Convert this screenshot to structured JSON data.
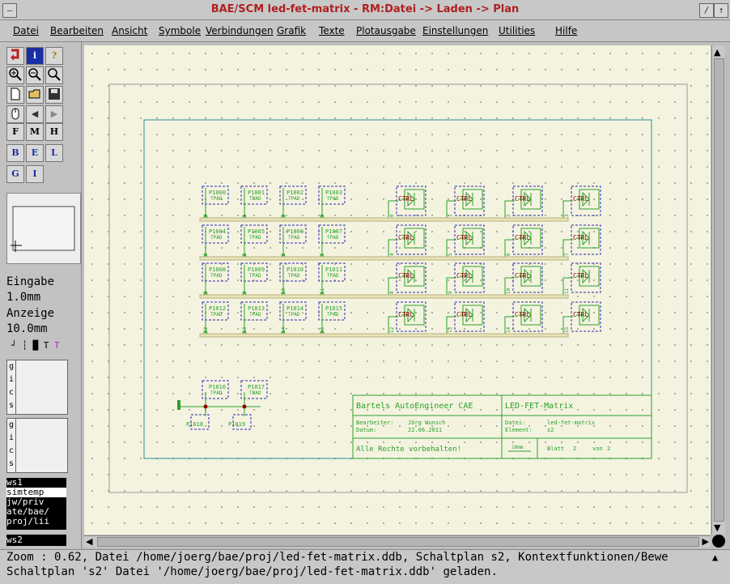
{
  "window": {
    "title": "BAE/SCM led-fet-matrix - RM:Datei -> Laden -> Plan"
  },
  "menu": [
    "Datei",
    "Bearbeiten",
    "Ansicht",
    "Symbole",
    "Verbindungen",
    "Grafik",
    "Texte",
    "Plotausgabe",
    "Einstellungen",
    "Utilities",
    "Hilfe"
  ],
  "sidebar": {
    "buttons_row4": [
      "F",
      "M",
      "H"
    ],
    "buttons_row5": [
      "B",
      "E",
      "L"
    ],
    "buttons_row6": [
      "G",
      "I"
    ],
    "eingabe_label": "Eingabe",
    "eingabe_value": "1.0mm",
    "anzeige_label": "Anzeige",
    "anzeige_value": "10.0mm",
    "tabs": [
      "g",
      "i",
      "c",
      "s"
    ],
    "sheet_w1": "s1",
    "dir_list": [
      "simtemp",
      "jw/priv",
      "ate/bae/",
      "proj/lii"
    ],
    "sheet_w2": "s2"
  },
  "schematic": {
    "pads": [
      [
        "P1000",
        "P1001",
        "P1002",
        "P1003"
      ],
      [
        "P1004",
        "P1005",
        "P1006",
        "P1007"
      ],
      [
        "P1008",
        "P1009",
        "P1010",
        "P1011"
      ],
      [
        "P1012",
        "P1013",
        "P1014",
        "P1015"
      ]
    ],
    "pad_type": "TPAD",
    "pad_nets": [
      [
        "0",
        "1",
        "2",
        "3"
      ],
      [
        "4",
        "5",
        "6",
        "7"
      ],
      [
        "8",
        "9",
        "10",
        "11"
      ],
      [
        "12",
        "13",
        "14",
        "15"
      ]
    ],
    "fet_label": "CTRL",
    "bottom_pads": [
      "P1016",
      "P1017"
    ],
    "bottom_labels": [
      "P1018",
      "P1019"
    ],
    "title_block": {
      "company": "Bartels AutoEngineer CAE",
      "project": "LED-FET-Matrix",
      "bearbeiter_label": "Bearbeiter:",
      "bearbeiter": "Jörg Wunsch",
      "datum_label": "Datum:",
      "datum": "22.06.2011",
      "datei_label": "Datei:",
      "datei": "led-fet-matrix",
      "element_label": "Element:",
      "element": "s2",
      "rights": "Alle Rechte vorbehalten!",
      "scale": "10mm",
      "blatt_label": "Blatt",
      "blatt": "2",
      "von_label": "von",
      "von": "2"
    }
  },
  "status": {
    "line1": "Zoom : 0.62, Datei /home/joerg/bae/proj/led-fet-matrix.ddb, Schaltplan s2, Kontextfunktionen/Bewe",
    "line2": "Schaltplan 's2' Datei '/home/joerg/bae/proj/led-fet-matrix.ddb' geladen."
  },
  "colors": {
    "title": "#b02020",
    "canvas": "#f4f3e0",
    "wire": "#2aa02a",
    "bus": "#c8c090",
    "frame": "#2a9090",
    "symbol": "#2a2ab0"
  }
}
